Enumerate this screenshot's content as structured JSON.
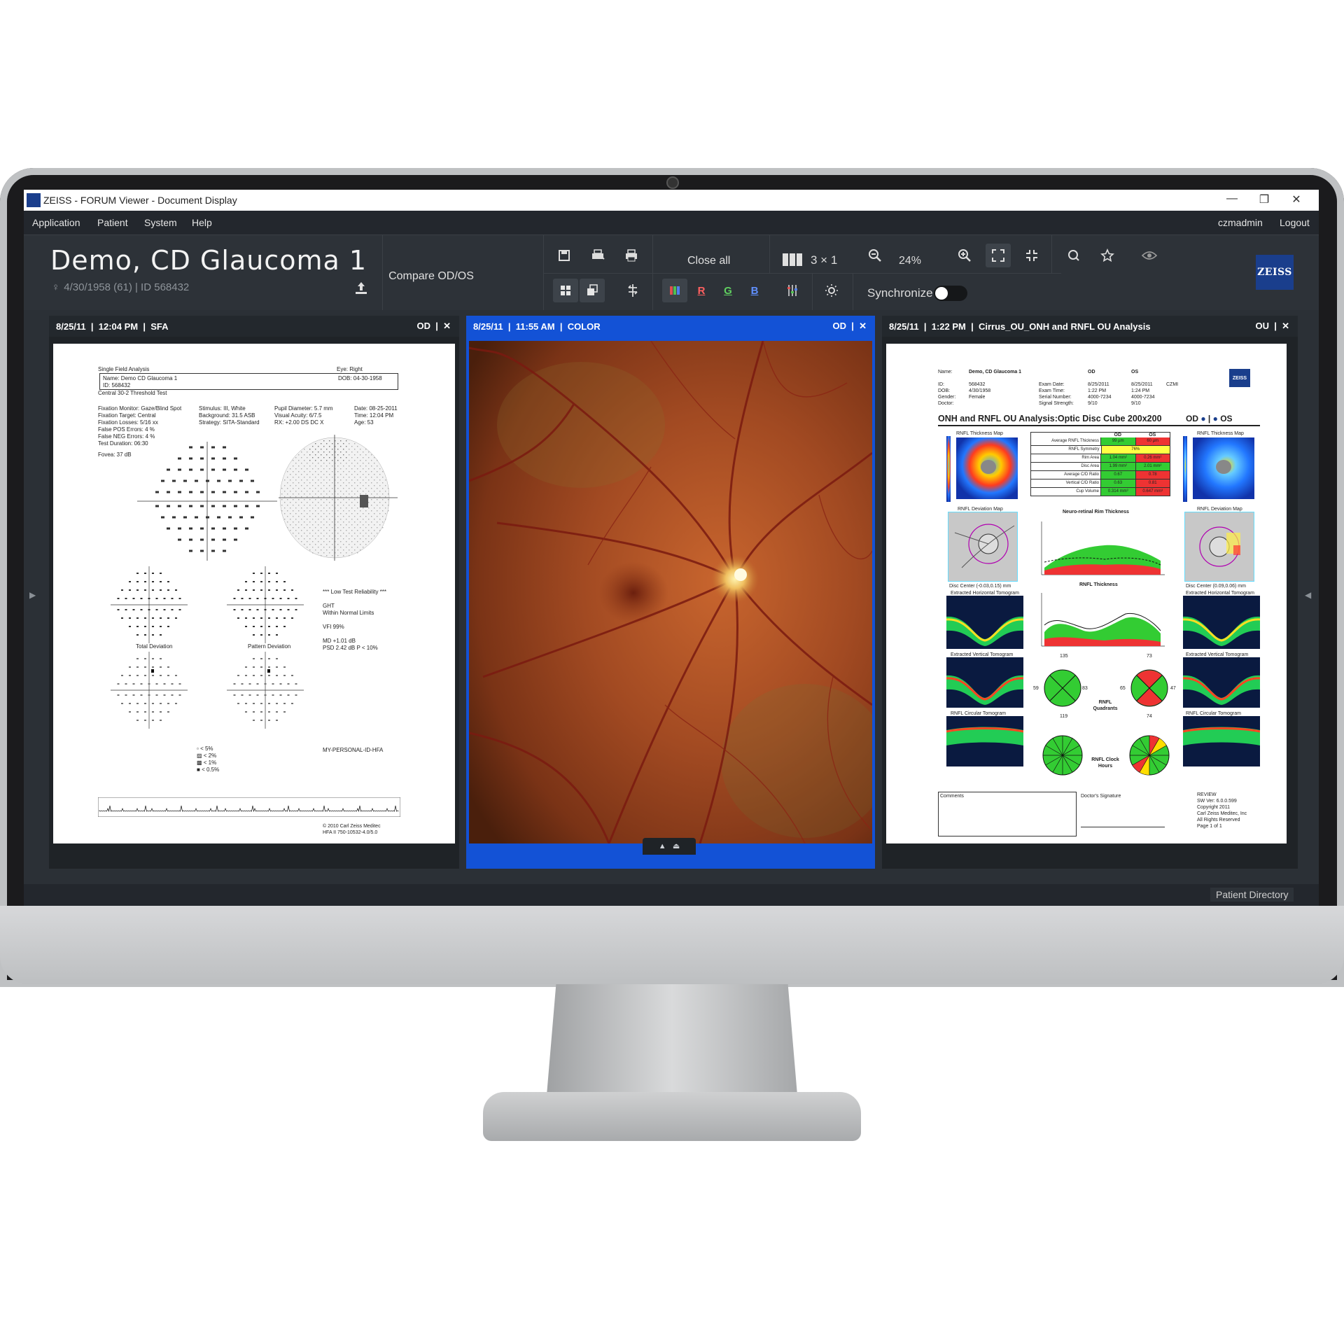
{
  "window": {
    "title": "ZEISS - FORUM Viewer - Document Display",
    "minimize_glyph": "—",
    "maximize_glyph": "❐",
    "close_glyph": "✕"
  },
  "menu": {
    "items": [
      "Application",
      "Patient",
      "System",
      "Help"
    ],
    "user": "czmadmin",
    "logout": "Logout"
  },
  "patient": {
    "name": "Demo, CD Glaucoma 1",
    "details": "4/30/1958 (61) | ID 568432"
  },
  "toolbar": {
    "compare": "Compare OD/OS",
    "close_all": "Close all",
    "layout": "3 × 1",
    "zoom": "24%",
    "synchronize": "Synchronize",
    "channel_r": "R",
    "channel_g": "G",
    "channel_b": "B"
  },
  "brand": {
    "logo_text": "ZEISS"
  },
  "panels": [
    {
      "date": "8/25/11",
      "time": "12:04 PM",
      "type": "SFA",
      "eye": "OD",
      "active": false
    },
    {
      "date": "8/25/11",
      "time": "11:55 AM",
      "type": "COLOR",
      "eye": "OD",
      "active": true
    },
    {
      "date": "8/25/11",
      "time": "1:22 PM",
      "type": "Cirrus_OU_ONH and RNFL OU Analysis",
      "eye": "OU",
      "active": false
    }
  ],
  "sfa_report": {
    "title": "Single Field Analysis",
    "eye": "Eye: Right",
    "name": "Name: Demo CD Glaucoma 1",
    "dob": "DOB: 04-30-1958",
    "id": "ID: 568432",
    "test": "Central 30-2 Threshold Test",
    "col1": [
      "Fixation Monitor: Gaze/Blind Spot",
      "Fixation Target: Central",
      "Fixation Losses: 5/16 xx",
      "False POS Errors: 4 %",
      "False NEG Errors: 4 %",
      "Test Duration: 06:30"
    ],
    "col2": [
      "Stimulus: III, White",
      "Background: 31.5 ASB",
      "Strategy: SITA-Standard"
    ],
    "col3": [
      "Pupil Diameter: 5.7 mm",
      "Visual Acuity: 6/7.5",
      "RX: +2.00 DS  DC X"
    ],
    "col4": [
      "Date: 08-25-2011",
      "Time: 12:04 PM",
      "Age: 53"
    ],
    "fovea": "Fovea: 37 dB",
    "reliability": "*** Low Test Reliability ***",
    "ght": "GHT",
    "ght_result": "Within Normal Limits",
    "vfi": "VFI   99%",
    "md": "MD    +1.01 dB",
    "psd": "PSD   2.42 dB P < 10%",
    "total_deviation": "Total Deviation",
    "pattern_deviation": "Pattern Deviation",
    "legend": [
      "< 5%",
      "< 2%",
      "< 1%",
      "< 0.5%"
    ],
    "personal_id": "MY-PERSONAL-ID-HFA",
    "copyright": "© 2010 Carl Zeiss Meditec",
    "model": "HFA II 750-10532-4.0/5.0"
  },
  "onh_report": {
    "name_label": "Name:",
    "name": "Demo, CD Glaucoma 1",
    "id_label": "ID:",
    "id": "568432",
    "dob_label": "DOB:",
    "dob": "4/30/1958",
    "gender_label": "Gender:",
    "gender": "Female",
    "doctor_label": "Doctor:",
    "od": "OD",
    "os": "OS",
    "exam_date_label": "Exam Date:",
    "exam_date_od": "8/25/2011",
    "exam_date_os": "8/25/2011",
    "exam_time_label": "Exam Time:",
    "exam_time_od": "1:22 PM",
    "exam_time_os": "1:24 PM",
    "serial_label": "Serial Number:",
    "serial_od": "4000-7234",
    "serial_os": "4000-7234",
    "signal_label": "Signal Strength:",
    "signal_od": "9/10",
    "signal_os": "9/10",
    "czmi": "CZMI",
    "heading": "ONH and RNFL OU Analysis:Optic Disc Cube 200x200",
    "thickness_map": "RNFL Thickness Map",
    "deviation_map": "RNFL Deviation Map",
    "table_rows": [
      {
        "label": "Average RNFL Thickness",
        "od": "99 µm",
        "os": "60 µm"
      },
      {
        "label": "RNFL Symmetry",
        "od": "76%",
        "os": ""
      },
      {
        "label": "Rim Area",
        "od": "1.04 mm²",
        "os": "0.26 mm²"
      },
      {
        "label": "Disc Area",
        "od": "1.99 mm²",
        "os": "2.01 mm²"
      },
      {
        "label": "Average C/D Ratio",
        "od": "0.67",
        "os": "0.78"
      },
      {
        "label": "Vertical C/D Ratio",
        "od": "0.63",
        "os": "0.81"
      },
      {
        "label": "Cup Volume",
        "od": "0.314 mm³",
        "os": "0.647 mm³"
      }
    ],
    "rim_title": "Neuro-retinal Rim Thickness",
    "rnfl_title": "RNFL Thickness",
    "disc_center_od": "Disc Center (-0.03,0.15) mm",
    "disc_center_os": "Disc Center (0.09,0.06) mm",
    "h_tomogram": "Extracted Horizontal Tomogram",
    "v_tomogram": "Extracted Vertical Tomogram",
    "c_tomogram": "RNFL Circular Tomogram",
    "quadrants": "RNFL Quadrants",
    "clock": "RNFL Clock Hours",
    "comments": "Comments",
    "signature": "Doctor's Signature",
    "footer": [
      "REVIEW",
      "SW Ver: 6.0.0.599",
      "Copyright 2011",
      "Carl Zeiss Meditec, Inc",
      "All Rights Reserved",
      "Page 1 of 1"
    ],
    "quad_od": [
      "135",
      "59",
      "83",
      "119"
    ],
    "quad_os": [
      "73",
      "47",
      "65",
      "74"
    ]
  },
  "status": {
    "patient_directory": "Patient Directory"
  }
}
